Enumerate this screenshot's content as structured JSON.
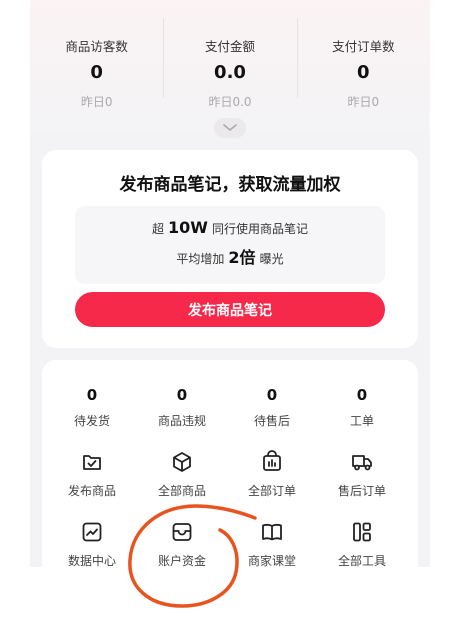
{
  "stats": [
    {
      "label": "商品访客数",
      "value": "0",
      "yesterday": "昨日0"
    },
    {
      "label": "支付金额",
      "value": "0.0",
      "yesterday": "昨日0.0"
    },
    {
      "label": "支付订单数",
      "value": "0",
      "yesterday": "昨日0"
    }
  ],
  "promo": {
    "title": "发布商品笔记，获取流量加权",
    "line1_prefix": "超",
    "line1_big": "10W",
    "line1_suffix": "同行使用商品笔记",
    "line2_prefix": "平均增加",
    "line2_big": "2倍",
    "line2_suffix": "曝光",
    "button_label": "发布商品笔记"
  },
  "counts": [
    {
      "value": "0",
      "label": "待发货"
    },
    {
      "value": "0",
      "label": "商品违规"
    },
    {
      "value": "0",
      "label": "待售后"
    },
    {
      "value": "0",
      "label": "工单"
    }
  ],
  "tools_row1": [
    {
      "label": "发布商品",
      "icon": "publish-product-icon"
    },
    {
      "label": "全部商品",
      "icon": "box-icon"
    },
    {
      "label": "全部订单",
      "icon": "orders-icon"
    },
    {
      "label": "售后订单",
      "icon": "truck-icon"
    }
  ],
  "tools_row2": [
    {
      "label": "数据中心",
      "icon": "trend-chart-icon"
    },
    {
      "label": "账户资金",
      "icon": "wallet-icon"
    },
    {
      "label": "商家课堂",
      "icon": "book-icon"
    },
    {
      "label": "全部工具",
      "icon": "tools-grid-icon"
    }
  ],
  "colors": {
    "accent": "#f7294a",
    "annotation": "#e8541f"
  }
}
